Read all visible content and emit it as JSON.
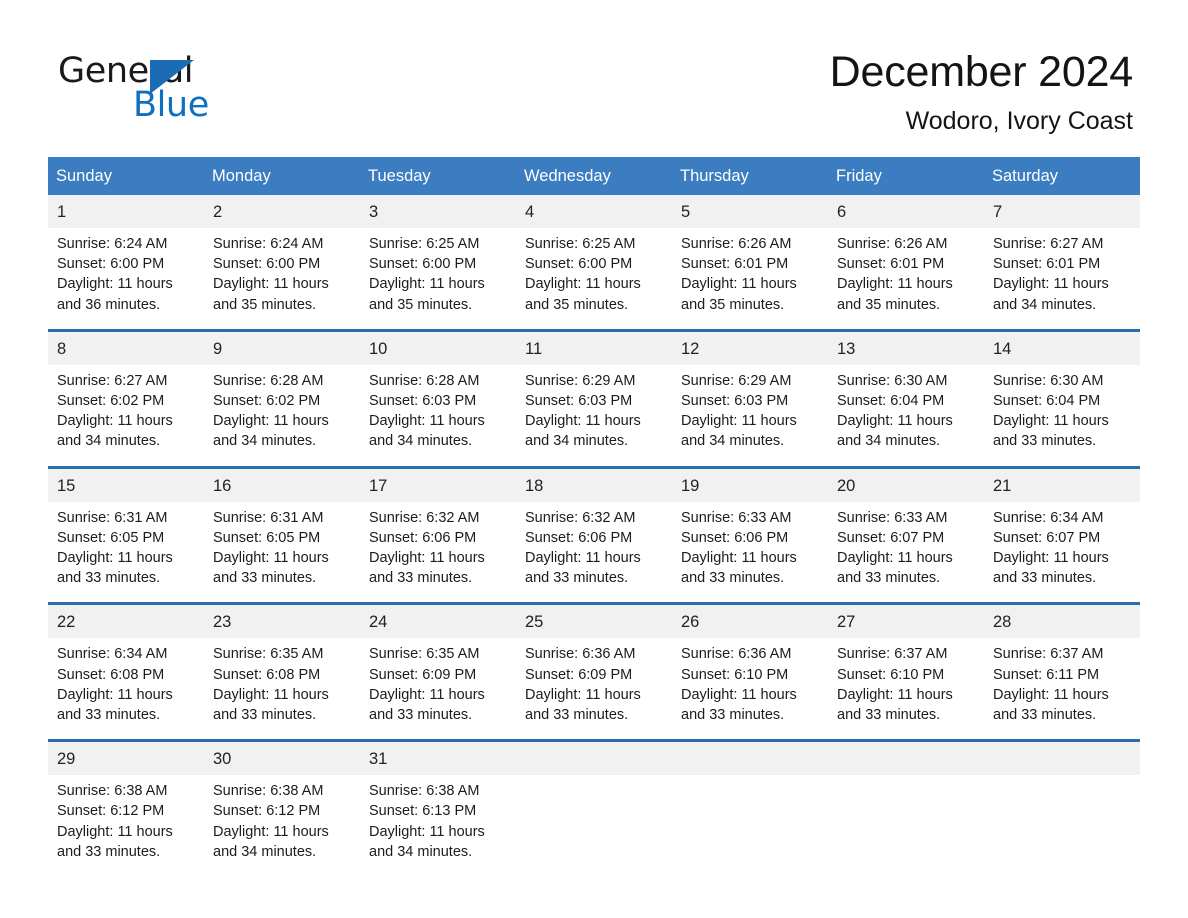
{
  "brand": {
    "name_part1": "General",
    "name_part2": "Blue",
    "accent_color": "#1070c0",
    "triangle_color": "#1b6cb4"
  },
  "header": {
    "month_title": "December 2024",
    "location": "Wodoro, Ivory Coast"
  },
  "colors": {
    "header_row_bg": "#3b7dc0",
    "week_divider": "#2b6cad",
    "daynum_band_bg": "#f1f1f1",
    "text": "#1c1c1c"
  },
  "weekdays": [
    "Sunday",
    "Monday",
    "Tuesday",
    "Wednesday",
    "Thursday",
    "Friday",
    "Saturday"
  ],
  "labels": {
    "sunrise_prefix": "Sunrise:",
    "sunset_prefix": "Sunset:",
    "daylight_prefix": "Daylight:"
  },
  "weeks": [
    {
      "days": [
        {
          "date": "1",
          "sunrise": "Sunrise: 6:24 AM",
          "sunset": "Sunset: 6:00 PM",
          "daylight_1": "Daylight: 11 hours",
          "daylight_2": "and 36 minutes."
        },
        {
          "date": "2",
          "sunrise": "Sunrise: 6:24 AM",
          "sunset": "Sunset: 6:00 PM",
          "daylight_1": "Daylight: 11 hours",
          "daylight_2": "and 35 minutes."
        },
        {
          "date": "3",
          "sunrise": "Sunrise: 6:25 AM",
          "sunset": "Sunset: 6:00 PM",
          "daylight_1": "Daylight: 11 hours",
          "daylight_2": "and 35 minutes."
        },
        {
          "date": "4",
          "sunrise": "Sunrise: 6:25 AM",
          "sunset": "Sunset: 6:00 PM",
          "daylight_1": "Daylight: 11 hours",
          "daylight_2": "and 35 minutes."
        },
        {
          "date": "5",
          "sunrise": "Sunrise: 6:26 AM",
          "sunset": "Sunset: 6:01 PM",
          "daylight_1": "Daylight: 11 hours",
          "daylight_2": "and 35 minutes."
        },
        {
          "date": "6",
          "sunrise": "Sunrise: 6:26 AM",
          "sunset": "Sunset: 6:01 PM",
          "daylight_1": "Daylight: 11 hours",
          "daylight_2": "and 35 minutes."
        },
        {
          "date": "7",
          "sunrise": "Sunrise: 6:27 AM",
          "sunset": "Sunset: 6:01 PM",
          "daylight_1": "Daylight: 11 hours",
          "daylight_2": "and 34 minutes."
        }
      ]
    },
    {
      "days": [
        {
          "date": "8",
          "sunrise": "Sunrise: 6:27 AM",
          "sunset": "Sunset: 6:02 PM",
          "daylight_1": "Daylight: 11 hours",
          "daylight_2": "and 34 minutes."
        },
        {
          "date": "9",
          "sunrise": "Sunrise: 6:28 AM",
          "sunset": "Sunset: 6:02 PM",
          "daylight_1": "Daylight: 11 hours",
          "daylight_2": "and 34 minutes."
        },
        {
          "date": "10",
          "sunrise": "Sunrise: 6:28 AM",
          "sunset": "Sunset: 6:03 PM",
          "daylight_1": "Daylight: 11 hours",
          "daylight_2": "and 34 minutes."
        },
        {
          "date": "11",
          "sunrise": "Sunrise: 6:29 AM",
          "sunset": "Sunset: 6:03 PM",
          "daylight_1": "Daylight: 11 hours",
          "daylight_2": "and 34 minutes."
        },
        {
          "date": "12",
          "sunrise": "Sunrise: 6:29 AM",
          "sunset": "Sunset: 6:03 PM",
          "daylight_1": "Daylight: 11 hours",
          "daylight_2": "and 34 minutes."
        },
        {
          "date": "13",
          "sunrise": "Sunrise: 6:30 AM",
          "sunset": "Sunset: 6:04 PM",
          "daylight_1": "Daylight: 11 hours",
          "daylight_2": "and 34 minutes."
        },
        {
          "date": "14",
          "sunrise": "Sunrise: 6:30 AM",
          "sunset": "Sunset: 6:04 PM",
          "daylight_1": "Daylight: 11 hours",
          "daylight_2": "and 33 minutes."
        }
      ]
    },
    {
      "days": [
        {
          "date": "15",
          "sunrise": "Sunrise: 6:31 AM",
          "sunset": "Sunset: 6:05 PM",
          "daylight_1": "Daylight: 11 hours",
          "daylight_2": "and 33 minutes."
        },
        {
          "date": "16",
          "sunrise": "Sunrise: 6:31 AM",
          "sunset": "Sunset: 6:05 PM",
          "daylight_1": "Daylight: 11 hours",
          "daylight_2": "and 33 minutes."
        },
        {
          "date": "17",
          "sunrise": "Sunrise: 6:32 AM",
          "sunset": "Sunset: 6:06 PM",
          "daylight_1": "Daylight: 11 hours",
          "daylight_2": "and 33 minutes."
        },
        {
          "date": "18",
          "sunrise": "Sunrise: 6:32 AM",
          "sunset": "Sunset: 6:06 PM",
          "daylight_1": "Daylight: 11 hours",
          "daylight_2": "and 33 minutes."
        },
        {
          "date": "19",
          "sunrise": "Sunrise: 6:33 AM",
          "sunset": "Sunset: 6:06 PM",
          "daylight_1": "Daylight: 11 hours",
          "daylight_2": "and 33 minutes."
        },
        {
          "date": "20",
          "sunrise": "Sunrise: 6:33 AM",
          "sunset": "Sunset: 6:07 PM",
          "daylight_1": "Daylight: 11 hours",
          "daylight_2": "and 33 minutes."
        },
        {
          "date": "21",
          "sunrise": "Sunrise: 6:34 AM",
          "sunset": "Sunset: 6:07 PM",
          "daylight_1": "Daylight: 11 hours",
          "daylight_2": "and 33 minutes."
        }
      ]
    },
    {
      "days": [
        {
          "date": "22",
          "sunrise": "Sunrise: 6:34 AM",
          "sunset": "Sunset: 6:08 PM",
          "daylight_1": "Daylight: 11 hours",
          "daylight_2": "and 33 minutes."
        },
        {
          "date": "23",
          "sunrise": "Sunrise: 6:35 AM",
          "sunset": "Sunset: 6:08 PM",
          "daylight_1": "Daylight: 11 hours",
          "daylight_2": "and 33 minutes."
        },
        {
          "date": "24",
          "sunrise": "Sunrise: 6:35 AM",
          "sunset": "Sunset: 6:09 PM",
          "daylight_1": "Daylight: 11 hours",
          "daylight_2": "and 33 minutes."
        },
        {
          "date": "25",
          "sunrise": "Sunrise: 6:36 AM",
          "sunset": "Sunset: 6:09 PM",
          "daylight_1": "Daylight: 11 hours",
          "daylight_2": "and 33 minutes."
        },
        {
          "date": "26",
          "sunrise": "Sunrise: 6:36 AM",
          "sunset": "Sunset: 6:10 PM",
          "daylight_1": "Daylight: 11 hours",
          "daylight_2": "and 33 minutes."
        },
        {
          "date": "27",
          "sunrise": "Sunrise: 6:37 AM",
          "sunset": "Sunset: 6:10 PM",
          "daylight_1": "Daylight: 11 hours",
          "daylight_2": "and 33 minutes."
        },
        {
          "date": "28",
          "sunrise": "Sunrise: 6:37 AM",
          "sunset": "Sunset: 6:11 PM",
          "daylight_1": "Daylight: 11 hours",
          "daylight_2": "and 33 minutes."
        }
      ]
    },
    {
      "days": [
        {
          "date": "29",
          "sunrise": "Sunrise: 6:38 AM",
          "sunset": "Sunset: 6:12 PM",
          "daylight_1": "Daylight: 11 hours",
          "daylight_2": "and 33 minutes."
        },
        {
          "date": "30",
          "sunrise": "Sunrise: 6:38 AM",
          "sunset": "Sunset: 6:12 PM",
          "daylight_1": "Daylight: 11 hours",
          "daylight_2": "and 34 minutes."
        },
        {
          "date": "31",
          "sunrise": "Sunrise: 6:38 AM",
          "sunset": "Sunset: 6:13 PM",
          "daylight_1": "Daylight: 11 hours",
          "daylight_2": "and 34 minutes."
        },
        {
          "date": "",
          "sunrise": "",
          "sunset": "",
          "daylight_1": "",
          "daylight_2": ""
        },
        {
          "date": "",
          "sunrise": "",
          "sunset": "",
          "daylight_1": "",
          "daylight_2": ""
        },
        {
          "date": "",
          "sunrise": "",
          "sunset": "",
          "daylight_1": "",
          "daylight_2": ""
        },
        {
          "date": "",
          "sunrise": "",
          "sunset": "",
          "daylight_1": "",
          "daylight_2": ""
        }
      ]
    }
  ]
}
